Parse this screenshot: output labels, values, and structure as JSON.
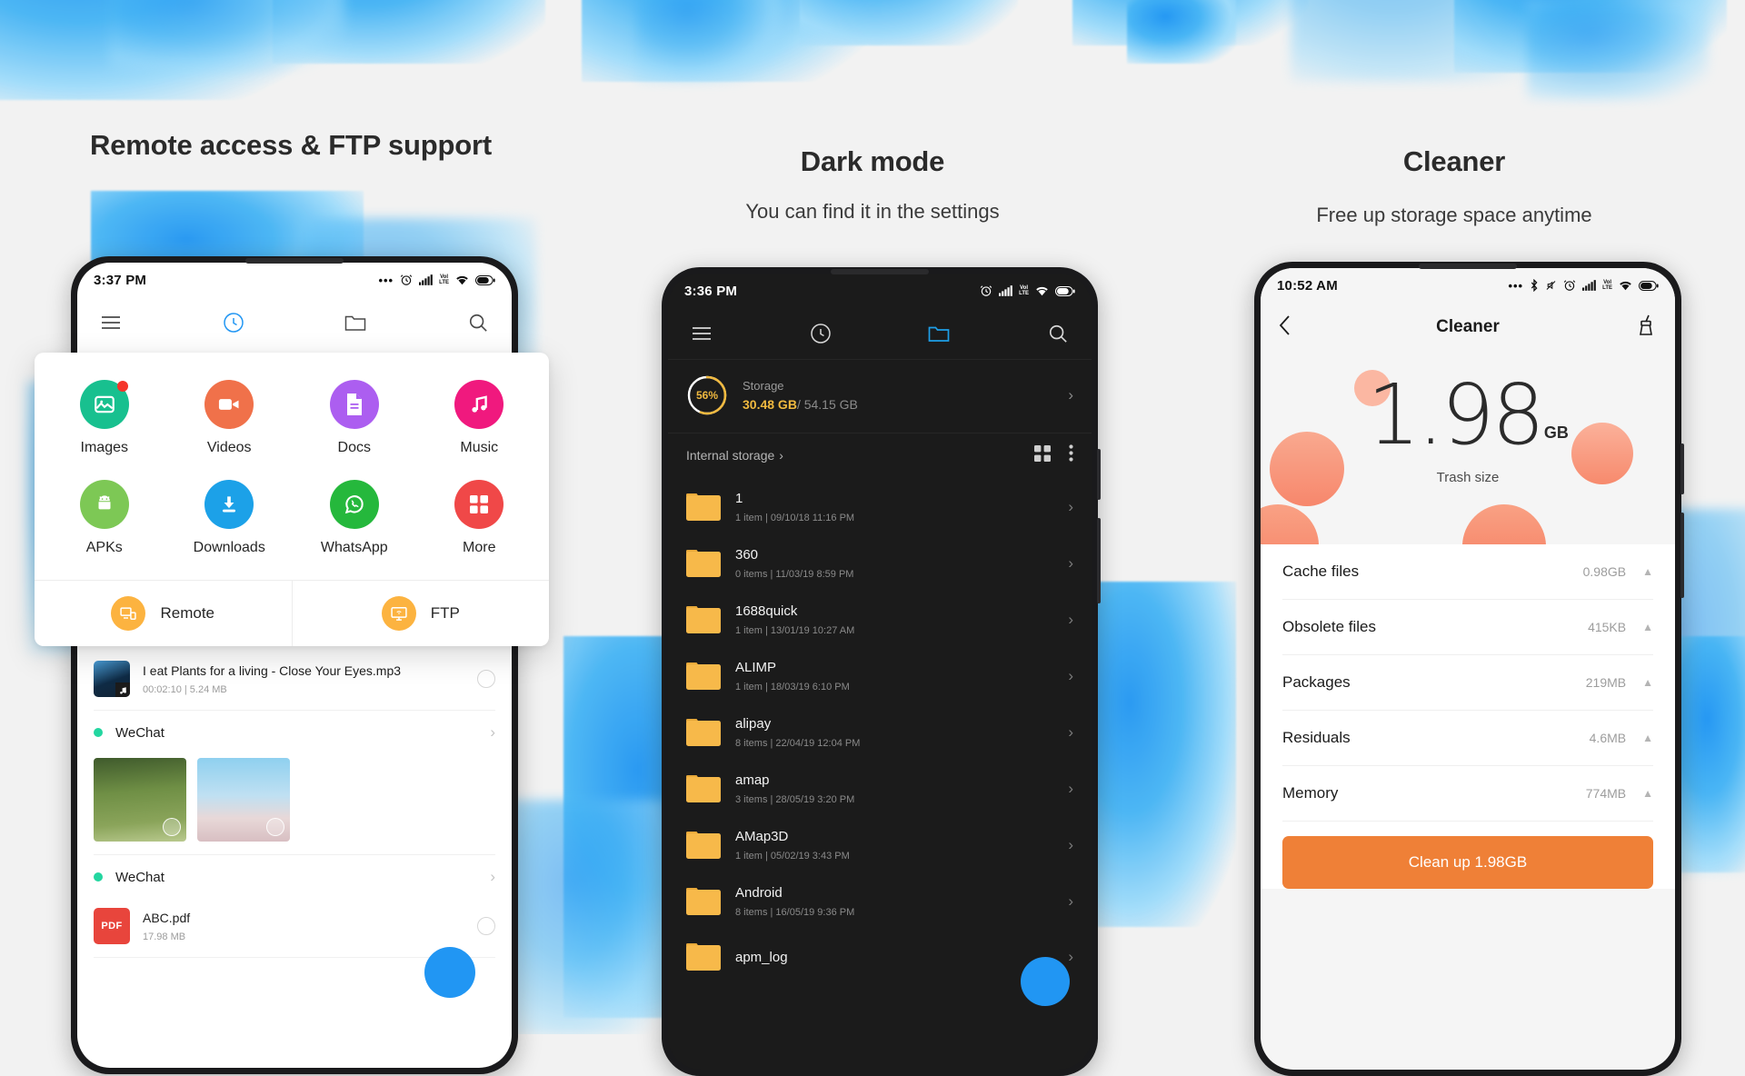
{
  "panels": [
    {
      "heading": "Remote access & FTP support",
      "subheading": "",
      "phone": {
        "status": {
          "time": "3:37 PM",
          "icons": [
            "dots-icon",
            "alarm-icon",
            "signal-icon",
            "volte-icon",
            "wifi-icon",
            "battery-icon"
          ]
        },
        "topnav": [
          "menu-icon",
          "recent-clock-icon",
          "folder-icon",
          "search-icon"
        ],
        "popup": {
          "items": [
            {
              "label": "Images",
              "icon": "image-icon",
              "color": "#18c08f",
              "badge": true
            },
            {
              "label": "Videos",
              "icon": "video-icon",
              "color": "#f0714a",
              "badge": false
            },
            {
              "label": "Docs",
              "icon": "document-icon",
              "color": "#ac5ef0",
              "badge": false
            },
            {
              "label": "Music",
              "icon": "music-icon",
              "color": "#f0197e",
              "badge": false
            },
            {
              "label": "APKs",
              "icon": "android-icon",
              "color": "#7dc855",
              "badge": false
            },
            {
              "label": "Downloads",
              "icon": "download-icon",
              "color": "#1ca1e8",
              "badge": false
            },
            {
              "label": "WhatsApp",
              "icon": "whatsapp-icon",
              "color": "#25b83c",
              "badge": false
            },
            {
              "label": "More",
              "icon": "grid-icon",
              "color": "#f04848",
              "badge": false
            }
          ],
          "footer": [
            {
              "label": "Remote",
              "icon": "remote-screen-icon"
            },
            {
              "label": "FTP",
              "icon": "ftp-monitor-icon"
            }
          ]
        },
        "files": [
          {
            "type": "audio",
            "name": "I eat Plants for a living - Close Your Eyes.mp3",
            "sub": "00:02:10  |  5.24 MB"
          },
          {
            "type": "group",
            "name": "WeChat"
          },
          {
            "type": "photos",
            "count": 2
          },
          {
            "type": "group",
            "name": "WeChat"
          },
          {
            "type": "pdf",
            "name": "ABC.pdf",
            "sub": "17.98 MB",
            "badge": "PDF"
          }
        ]
      }
    },
    {
      "heading": "Dark mode",
      "subheading": "You can find it in the settings",
      "phone": {
        "status": {
          "time": "3:36 PM",
          "icons": [
            "alarm-icon",
            "signal-icon",
            "volte-icon",
            "wifi-icon",
            "battery-icon"
          ]
        },
        "topnav": [
          "menu-icon",
          "recent-clock-icon",
          "folder-icon",
          "search-icon"
        ],
        "storage": {
          "percent": "56%",
          "percent_value": 56,
          "label": "Storage",
          "used": "30.48 GB",
          "separator": "/ ",
          "total": "54.15 GB",
          "accent": "#f0b93f"
        },
        "breadcrumb": "Internal storage",
        "breadcrumb_icons": [
          "grid-view-icon",
          "more-vertical-icon"
        ],
        "folders": [
          {
            "name": "1",
            "sub": "1 item  |  09/10/18 11:16 PM"
          },
          {
            "name": "360",
            "sub": "0 items  |  11/03/19 8:59 PM"
          },
          {
            "name": "1688quick",
            "sub": "1 item  |  13/01/19 10:27 AM"
          },
          {
            "name": "ALIMP",
            "sub": "1 item  |  18/03/19 6:10 PM"
          },
          {
            "name": "alipay",
            "sub": "8 items  |  22/04/19 12:04 PM"
          },
          {
            "name": "amap",
            "sub": "3 items  |  28/05/19 3:20 PM"
          },
          {
            "name": "AMap3D",
            "sub": "1 item  |  05/02/19 3:43 PM"
          },
          {
            "name": "Android",
            "sub": "8 items  |  16/05/19 9:36 PM"
          },
          {
            "name": "apm_log",
            "sub": ""
          }
        ]
      }
    },
    {
      "heading": "Cleaner",
      "subheading": "Free up storage space anytime",
      "phone": {
        "status": {
          "time": "10:52 AM",
          "icons": [
            "dots-icon",
            "bluetooth-icon",
            "mute-icon",
            "alarm-icon",
            "signal-icon",
            "volte-icon",
            "wifi-icon",
            "battery-icon"
          ]
        },
        "appbar": {
          "back": "back-chevron-icon",
          "title": "Cleaner",
          "action": "broom-icon"
        },
        "hero": {
          "value": "1.98",
          "unit": "GB",
          "caption": "Trash size"
        },
        "rows": [
          {
            "label": "Cache files",
            "size": "0.98GB"
          },
          {
            "label": "Obsolete files",
            "size": "415KB"
          },
          {
            "label": "Packages",
            "size": "219MB"
          },
          {
            "label": "Residuals",
            "size": "4.6MB"
          },
          {
            "label": "Memory",
            "size": "774MB"
          }
        ],
        "clean_button": "Clean up 1.98GB",
        "button_color": "#ef8037"
      }
    }
  ]
}
